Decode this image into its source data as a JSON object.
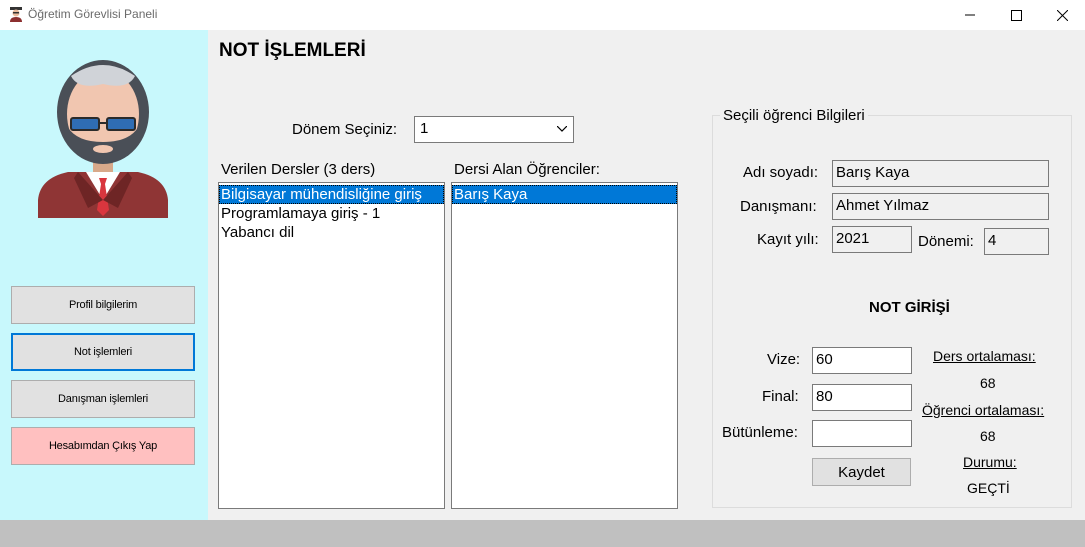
{
  "window": {
    "title": "Öğretim Görevlisi Paneli"
  },
  "sidebar": {
    "buttons": [
      {
        "label": "Profil bilgilerim"
      },
      {
        "label": "Not işlemleri"
      },
      {
        "label": "Danışman işlemleri"
      },
      {
        "label": "Hesabımdan Çıkış Yap"
      }
    ],
    "colors": {
      "background": "#c8f8fc",
      "logout": "#ffc0c0",
      "active_border": "#0078d7"
    }
  },
  "main": {
    "title": "NOT İŞLEMLERİ",
    "term_label": "Dönem Seçiniz:",
    "term_value": "1",
    "courses_label": "Verilen Dersler (3 ders)",
    "courses": [
      "Bilgisayar mühendisliğine giriş",
      "Programlamaya giriş - 1",
      "Yabancı dil"
    ],
    "students_label": "Dersi Alan Öğrenciler:",
    "students": [
      "Barış Kaya"
    ]
  },
  "student_info": {
    "legend": "Seçili öğrenci Bilgileri",
    "name_label": "Adı soyadı:",
    "name": "Barış Kaya",
    "advisor_label": "Danışmanı:",
    "advisor": "Ahmet Yılmaz",
    "year_label": "Kayıt yılı:",
    "year": "2021",
    "term_label": "Dönemi:",
    "term": "4"
  },
  "grade_entry": {
    "heading": "NOT GİRİŞİ",
    "midterm_label": "Vize:",
    "midterm": "60",
    "final_label": "Final:",
    "final": "80",
    "makeup_label": "Bütünleme:",
    "makeup": "",
    "save_label": "Kaydet",
    "course_avg_label": "Ders ortalaması:",
    "course_avg": "68",
    "student_avg_label": "Öğrenci ortalaması:",
    "student_avg": "68",
    "status_label": "Durumu:",
    "status": "GEÇTİ"
  }
}
